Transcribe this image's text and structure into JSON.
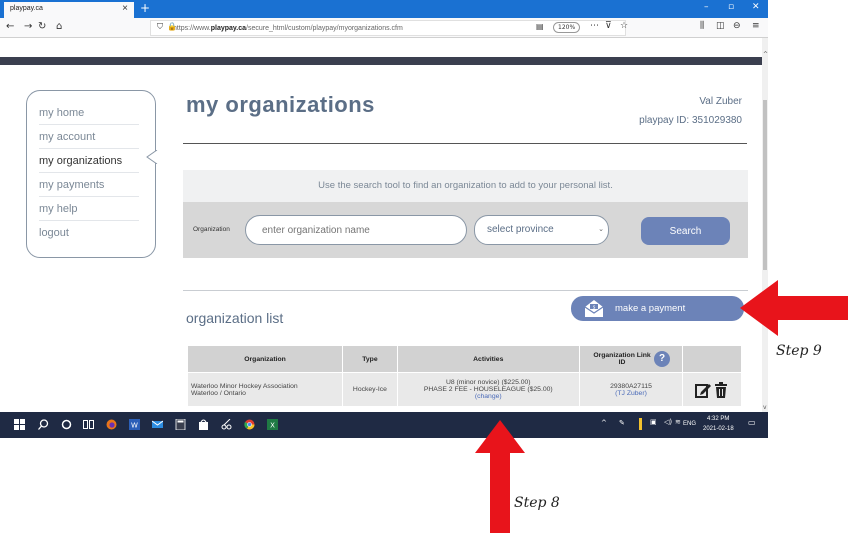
{
  "browser": {
    "tab_title": "playpay.ca",
    "url_prefix": "https://www.",
    "url_domain": "playpay.ca",
    "url_path": "/secure_html/custom/playpay/myorganizations.cfm",
    "zoom": "120%"
  },
  "sidebar": {
    "items": [
      {
        "label": "my home"
      },
      {
        "label": "my account"
      },
      {
        "label": "my organizations"
      },
      {
        "label": "my payments"
      },
      {
        "label": "my help"
      },
      {
        "label": "logout"
      }
    ]
  },
  "header": {
    "title": "my organizations",
    "user_name": "Val Zuber",
    "user_id": "playpay ID: 351029380"
  },
  "search": {
    "hint": "Use the search tool to find an organization to add to your personal list.",
    "org_label": "Organization",
    "placeholder": "enter organization name",
    "province_selected": "select province",
    "button": "Search"
  },
  "org_list": {
    "title": "organization list",
    "pay_button": "make a payment",
    "columns": [
      "Organization",
      "Type",
      "Activities",
      "Organization Link ID",
      ""
    ],
    "rows": [
      {
        "org_name": "Waterloo Minor Hockey Association",
        "org_location": "Waterloo / Ontario",
        "type": "Hockey-Ice",
        "activity1": "U8 (minor novice) ($225.00)",
        "activity2": "PHASE 2 FEE - HOUSELEAGUE ($25.00)",
        "change": "(change)",
        "link_id": "29380A27115",
        "link_user": "(TJ Zuber)"
      }
    ]
  },
  "taskbar": {
    "time": "4:32 PM",
    "date": "2021-02-18",
    "lang": "ENG"
  },
  "annotations": {
    "step8": "Step 8",
    "step9": "Step 9",
    "arrow_color": "#e8141b"
  },
  "colors": {
    "accent": "#6c83b8",
    "text_muted": "#5b6e86",
    "browser_blue": "#1a71d2",
    "taskbar": "#1f2a44"
  }
}
